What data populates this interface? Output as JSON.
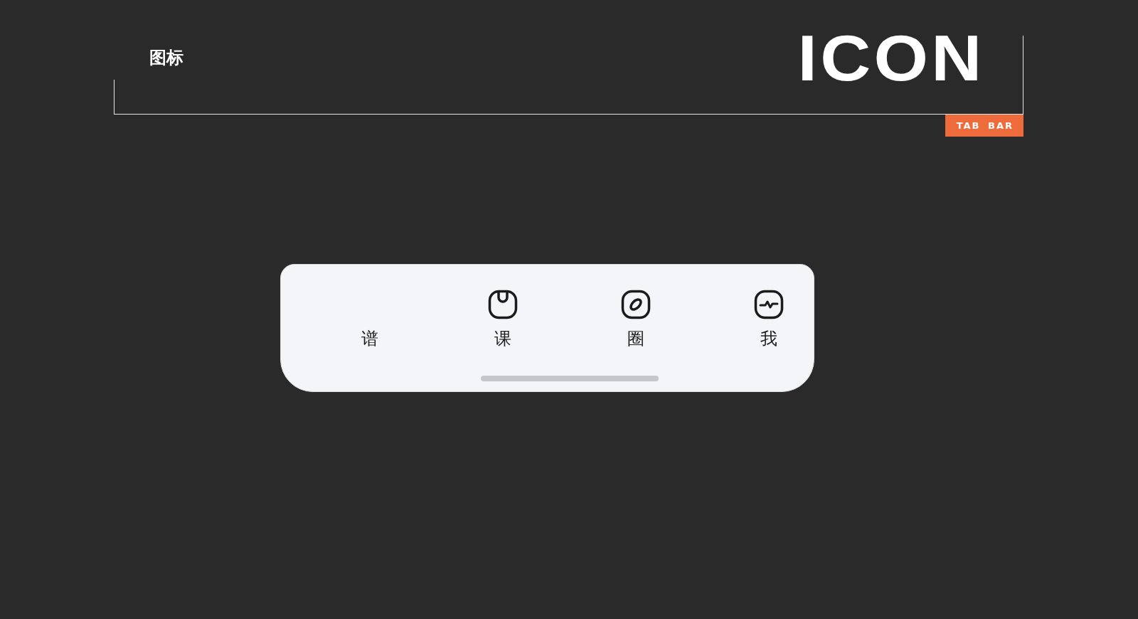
{
  "header": {
    "title": "图标",
    "logo": "ICON",
    "badge": "TAB BAR"
  },
  "tab_bar": {
    "tabs": [
      {
        "label": "谱",
        "kind": "plain"
      },
      {
        "label": "课",
        "kind": "notch"
      },
      {
        "label": "圈",
        "kind": "ring"
      },
      {
        "label": "我",
        "kind": "pulse"
      }
    ]
  }
}
